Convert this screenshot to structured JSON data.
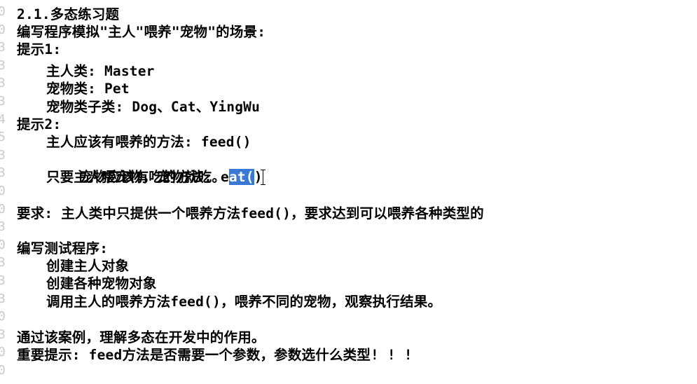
{
  "gutter": {
    "numbers": [
      "0",
      "0",
      "3",
      "3",
      "3",
      "3",
      "4",
      "5",
      "3",
      "3",
      "0",
      "0",
      "3",
      "0",
      "3",
      "3",
      "3",
      "0",
      "3",
      "0",
      "0"
    ]
  },
  "doc": {
    "lines": [
      {
        "text": "2.1.多态练习题",
        "indent": false
      },
      {
        "text": "编写程序模拟\"主人\"喂养\"宠物\"的场景:",
        "indent": false
      },
      {
        "text": "提示1:",
        "indent": false
      },
      {
        "text": "主人类: Master",
        "indent": true
      },
      {
        "text": "宠物类: Pet",
        "indent": true
      },
      {
        "text": "宠物类子类: Dog、Cat、YingWu",
        "indent": true
      },
      {
        "text": "提示2:",
        "indent": false
      },
      {
        "text": "主人应该有喂养的方法: feed()",
        "indent": true
      },
      {
        "text": "宠物应该有吃的方法: e",
        "indent": true,
        "selected": "at(",
        "after": ")"
      },
      {
        "text": "只要主人喂宠物，宠物就吃。",
        "indent": true
      },
      {
        "text": "",
        "indent": false
      },
      {
        "text": "要求: 主人类中只提供一个喂养方法feed()，要求达到可以喂养各种类型的",
        "indent": false
      },
      {
        "text": "",
        "indent": false
      },
      {
        "text": "编写测试程序:",
        "indent": false
      },
      {
        "text": "创建主人对象",
        "indent": true
      },
      {
        "text": "创建各种宠物对象",
        "indent": true
      },
      {
        "text": "调用主人的喂养方法feed()，喂养不同的宠物，观察执行结果。",
        "indent": true
      },
      {
        "text": "",
        "indent": false
      },
      {
        "text": "通过该案例，理解多态在开发中的作用。",
        "indent": false
      },
      {
        "text": "重要提示: feed方法是否需要一个参数，参数选什么类型! ! !",
        "indent": false
      }
    ]
  }
}
